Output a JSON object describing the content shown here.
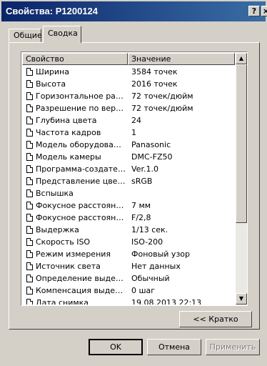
{
  "window": {
    "title": "Свойства: P1200124",
    "help_label": "?",
    "close_label": "×"
  },
  "tabs": [
    {
      "label": "Общие",
      "active": false
    },
    {
      "label": "Сводка",
      "active": true
    }
  ],
  "list": {
    "columns": [
      "Свойство",
      "Значение"
    ],
    "rows": [
      {
        "name": "Ширина",
        "value": "3584 точек"
      },
      {
        "name": "Высота",
        "value": "2016 точек"
      },
      {
        "name": "Горизонтальное разр...",
        "value": "72 точек/дюйм"
      },
      {
        "name": "Разрешение по верти...",
        "value": "72 точек/дюйм"
      },
      {
        "name": "Глубина цвета",
        "value": "24"
      },
      {
        "name": "Частота кадров",
        "value": "1"
      },
      {
        "name": "Модель оборудования",
        "value": "Panasonic"
      },
      {
        "name": "Модель камеры",
        "value": "DMC-FZ50"
      },
      {
        "name": "Программа-создатель",
        "value": "Ver.1.0"
      },
      {
        "name": "Представление цвета",
        "value": "sRGB"
      },
      {
        "name": "Вспышка",
        "value": ""
      },
      {
        "name": "Фокусное расстояние",
        "value": "7 мм"
      },
      {
        "name": "Фокусное расстояние",
        "value": "F/2,8"
      },
      {
        "name": "Выдержка",
        "value": "1/13 сек."
      },
      {
        "name": "Скорость ISO",
        "value": "ISO-200"
      },
      {
        "name": "Режим измерения",
        "value": "Фоновый узор"
      },
      {
        "name": "Источник света",
        "value": "Нет данных"
      },
      {
        "name": "Определение выдержки",
        "value": "Обычный"
      },
      {
        "name": "Компенсация выдержки",
        "value": "0 шаг"
      },
      {
        "name": "Дата снимка",
        "value": "19.08.2013 22:13"
      }
    ]
  },
  "buttons": {
    "brief": "<< Кратко",
    "ok": "OK",
    "cancel": "Отмена",
    "apply": "Применить"
  },
  "icons": {
    "row_icon": "document-icon",
    "scroll_up": "arrow-up-icon",
    "scroll_down": "arrow-down-icon"
  }
}
